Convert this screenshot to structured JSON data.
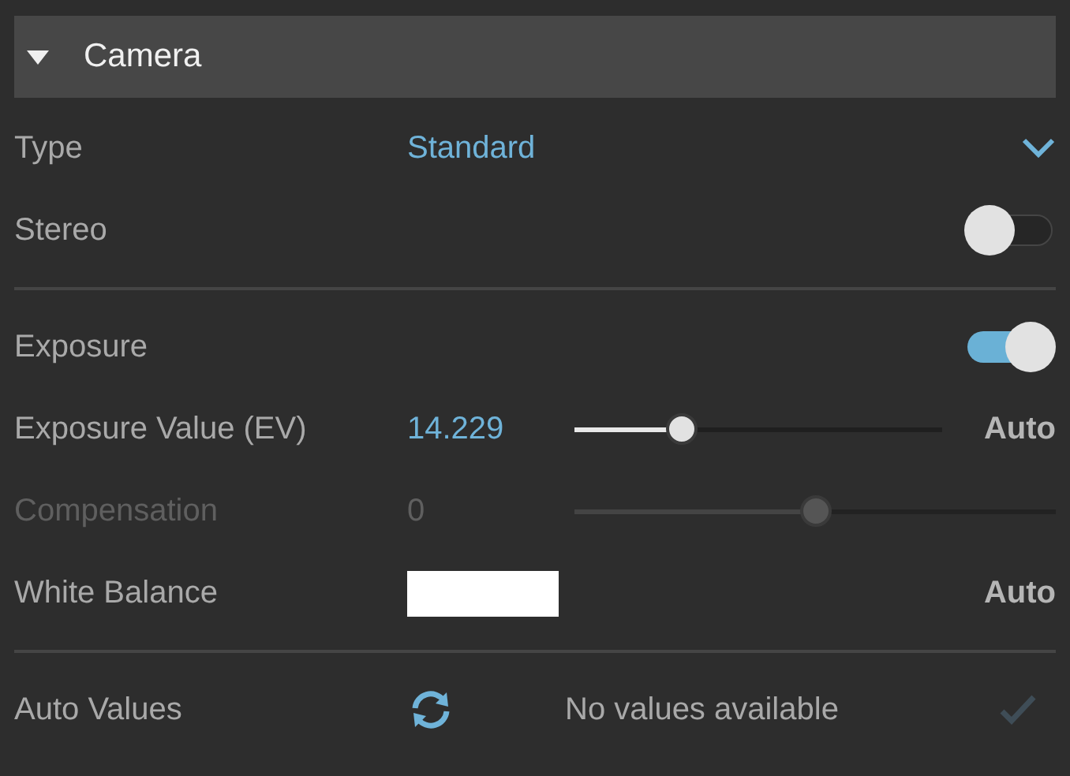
{
  "section": {
    "title": "Camera",
    "expanded": true
  },
  "rows": [
    {
      "kind": "dropdown",
      "label": "Type",
      "value": "Standard"
    },
    {
      "kind": "toggle",
      "label": "Stereo",
      "on": false
    },
    {
      "kind": "divider"
    },
    {
      "kind": "toggle",
      "label": "Exposure",
      "on": true
    },
    {
      "kind": "slider",
      "label": "Exposure Value (EV)",
      "value": "14.229",
      "level": 0.29,
      "disabled": false,
      "action": "Auto"
    },
    {
      "kind": "slider",
      "label": "Compensation",
      "value": "0",
      "level": 0.5,
      "disabled": true
    },
    {
      "kind": "color",
      "label": "White Balance",
      "color": "#ffffff",
      "action": "Auto"
    },
    {
      "kind": "divider"
    },
    {
      "kind": "status",
      "label": "Auto Values",
      "message": "No values available"
    }
  ]
}
